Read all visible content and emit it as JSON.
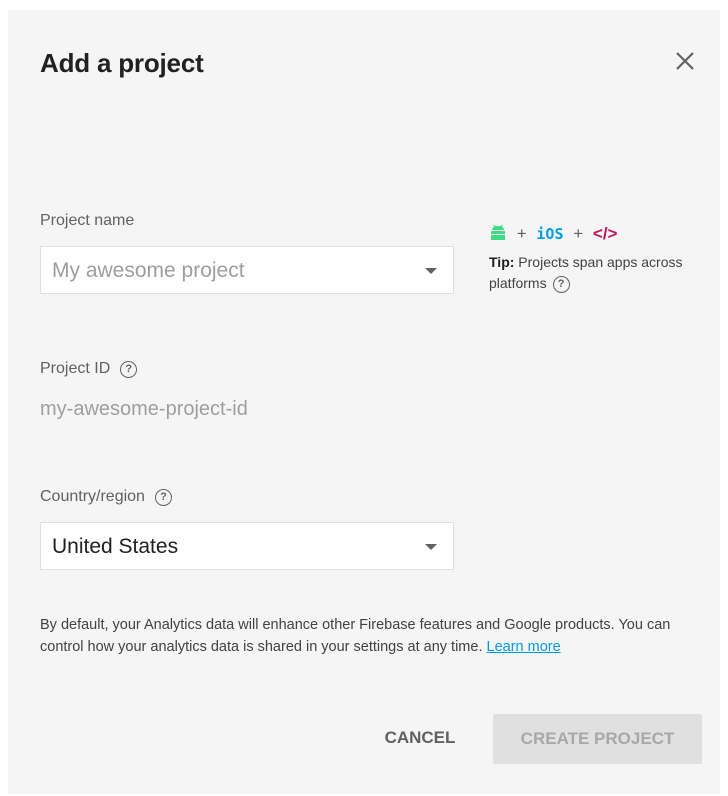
{
  "dialog": {
    "title": "Add a project"
  },
  "project_name": {
    "label": "Project name",
    "placeholder": "My awesome project"
  },
  "tip": {
    "platforms": {
      "android_icon": "android-icon",
      "plus": "+",
      "ios": "iOS",
      "web": "</>"
    },
    "bold": "Tip:",
    "text": " Projects span apps across platforms"
  },
  "project_id": {
    "label": "Project ID",
    "value": "my-awesome-project-id"
  },
  "country": {
    "label": "Country/region",
    "value": "United States"
  },
  "disclaimer": {
    "text": "By default, your Analytics data will enhance other Firebase features and Google products. You can control how your analytics data is shared in your settings at any time. ",
    "link": "Learn more"
  },
  "actions": {
    "cancel": "CANCEL",
    "create": "CREATE PROJECT"
  },
  "colors": {
    "dialog_bg": "#f5f5f5",
    "android": "#3ddc84",
    "ios": "#039be5",
    "web": "#c2185b",
    "link": "#039be5",
    "disabled_button": "#e0e0e0"
  }
}
